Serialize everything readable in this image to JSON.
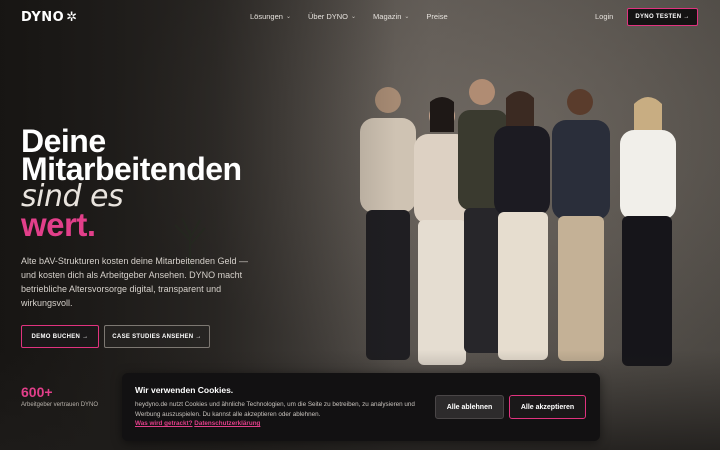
{
  "nav": {
    "logo": "DYNO",
    "logo_mark": "✲",
    "links": [
      {
        "label": "Lösungen",
        "has_dropdown": true
      },
      {
        "label": "Über DYNO",
        "has_dropdown": true
      },
      {
        "label": "Magazin",
        "has_dropdown": true
      },
      {
        "label": "Preise",
        "has_dropdown": false
      }
    ],
    "chevron": "⌄",
    "login": "Login",
    "cta": "DYNO TESTEN →"
  },
  "hero": {
    "line1": "Deine",
    "line2": "Mitarbeitenden",
    "line3": "sind es",
    "line4": "wert.",
    "description": "Alte bAV-Strukturen kosten deine Mitarbeitenden Geld — und kosten dich als Arbeitgeber Ansehen. DYNO macht betriebliche Altersvorsorge digital, transparent und wirkungsvoll.",
    "btn_demo": "DEMO BUCHEN →",
    "btn_cases": "CASE STUDIES ANSEHEN →",
    "stat_number": "600+",
    "stat_label": "Arbeitgeber vertrauen DYNO"
  },
  "cookie": {
    "title": "Wir verwenden Cookies.",
    "text": "heydyno.de nutzt Cookies und ähnliche Technologien, um die Seite zu betreiben, zu analysieren und Werbung auszuspielen. Du kannst alle akzeptieren oder ablehnen.",
    "link_tracking": "Was wird getrackt?",
    "link_privacy": "Datenschutzerklärung",
    "btn_deny": "Alle ablehnen",
    "btn_accept": "Alle akzeptieren"
  },
  "colors": {
    "accent": "#e23f8a",
    "dark": "#121112"
  }
}
